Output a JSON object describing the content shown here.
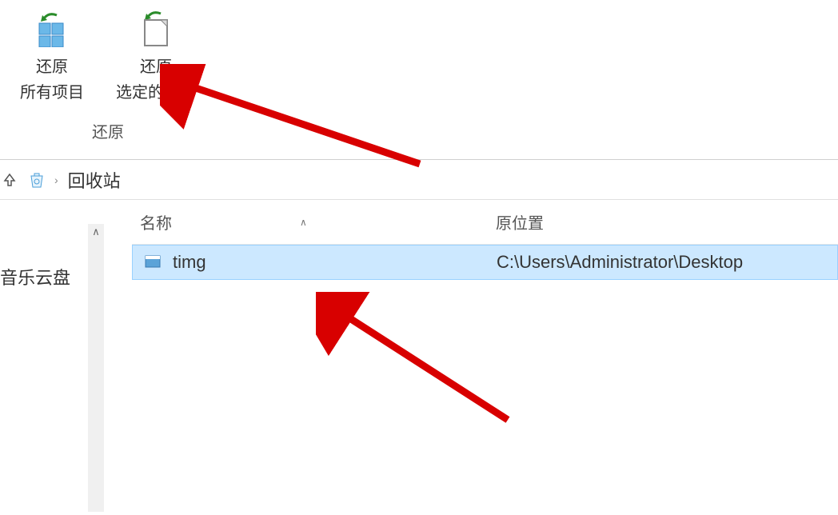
{
  "ribbon": {
    "restore_all": {
      "line1": "还原",
      "line2": "所有项目"
    },
    "restore_selected": {
      "line1": "还原",
      "line2": "选定的项目"
    },
    "group_label": "还原"
  },
  "address": {
    "location": "回收站"
  },
  "sidebar": {
    "item_cloud": "音乐云盘"
  },
  "columns": {
    "name": "名称",
    "original_location": "原位置"
  },
  "files": [
    {
      "name": "timg",
      "original_location": "C:\\Users\\Administrator\\Desktop"
    }
  ]
}
